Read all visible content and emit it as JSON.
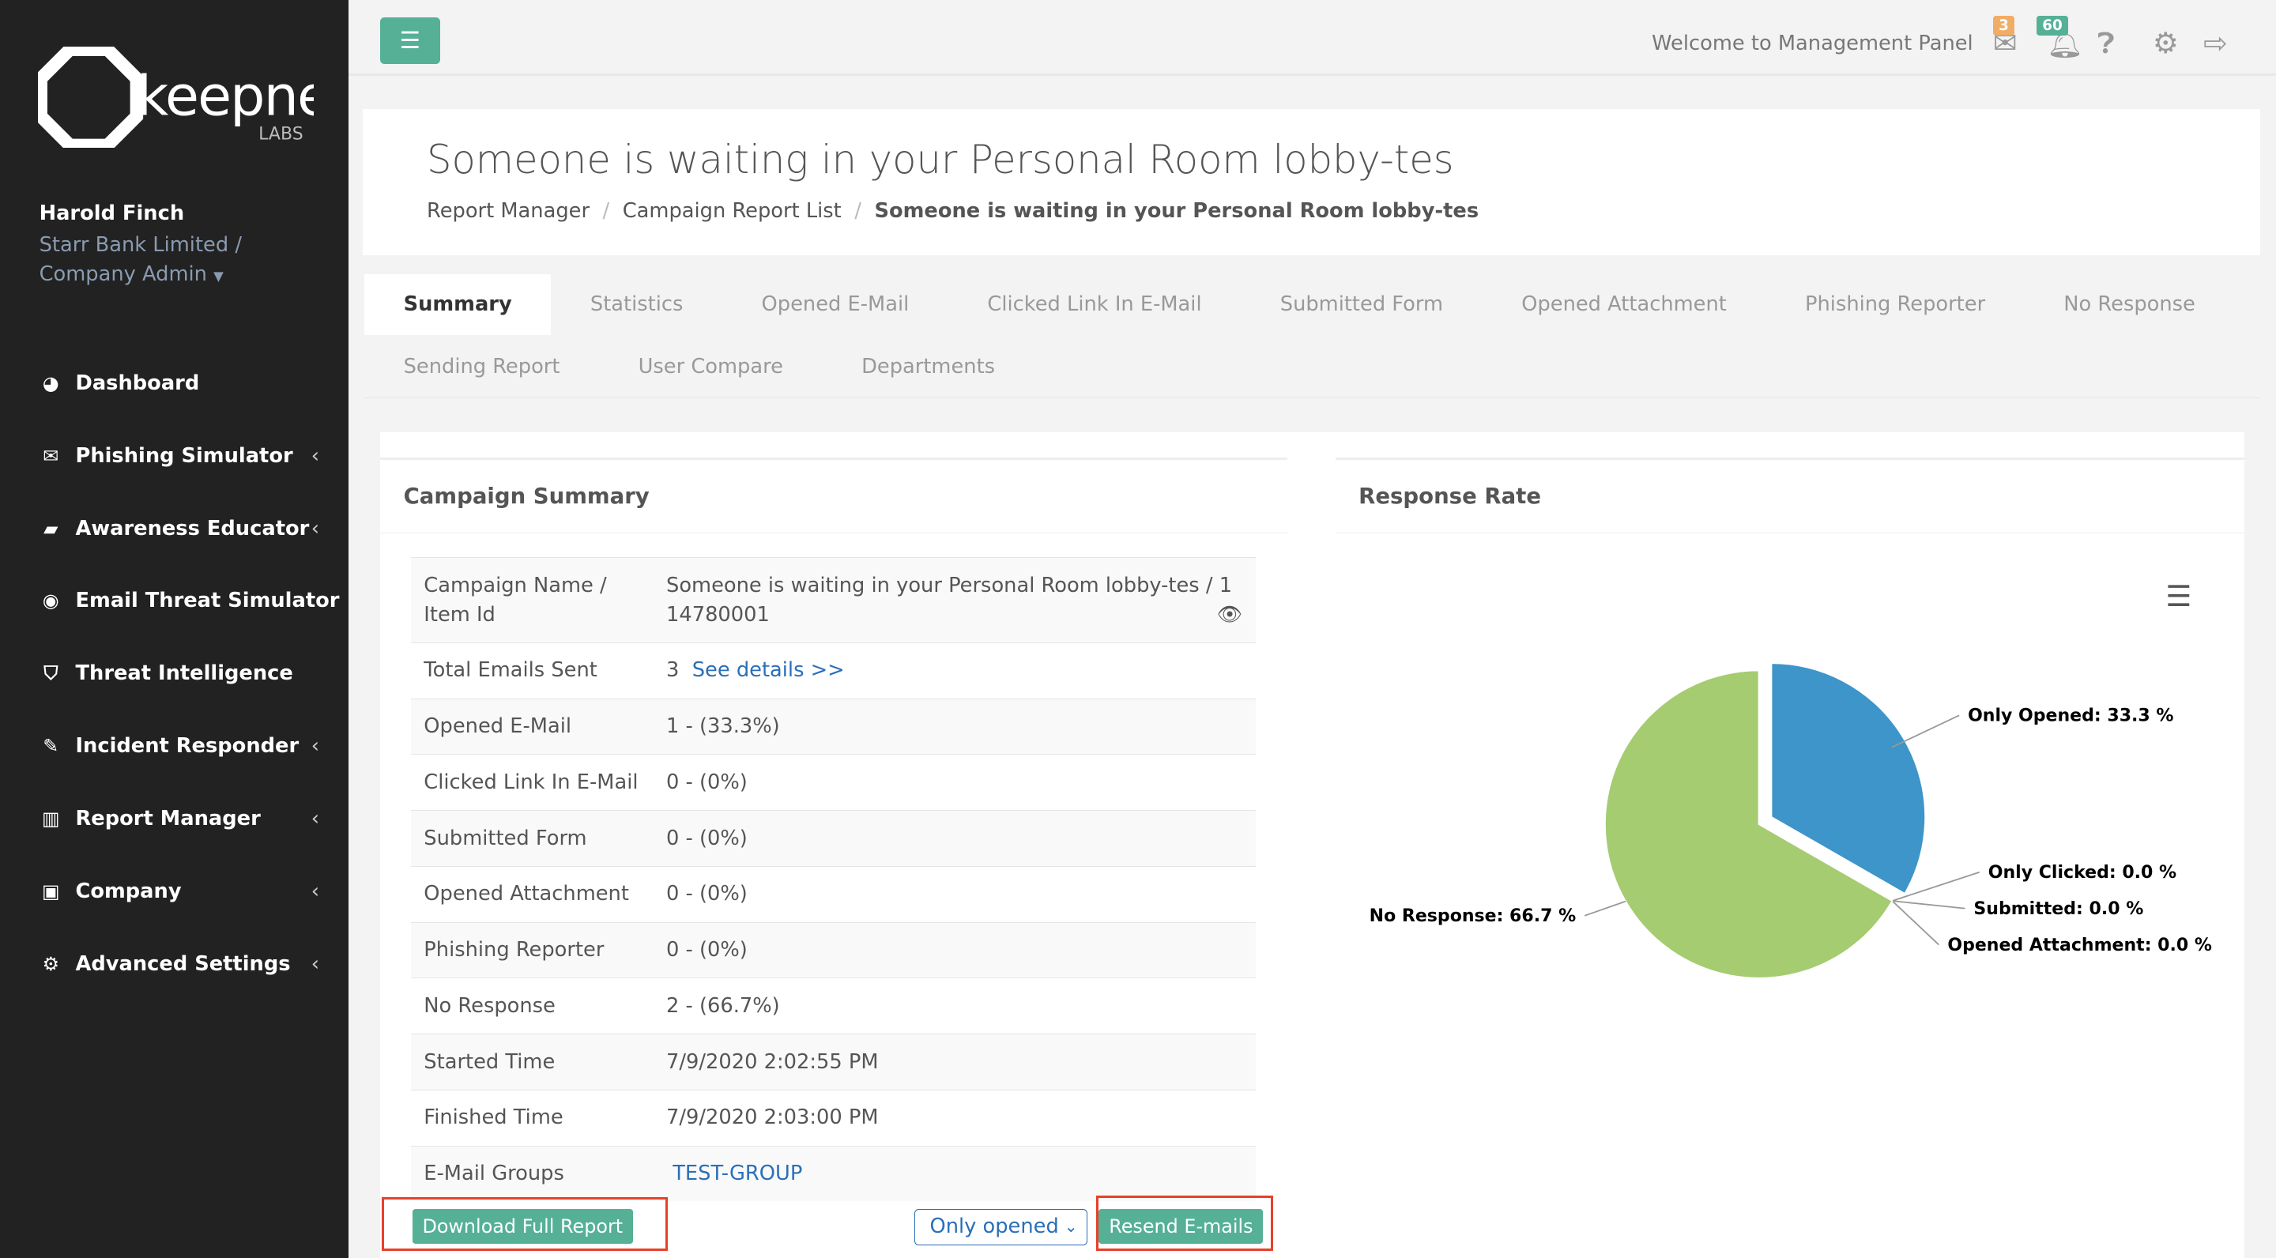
{
  "brand": {
    "name": "keepnet",
    "sub": "LABS"
  },
  "user": {
    "name": "Harold Finch",
    "company": "Starr Bank Limited /",
    "role": "Company Admin"
  },
  "sidebar": {
    "items": [
      {
        "label": "Dashboard",
        "icon": "dashboard-icon",
        "chevron": false
      },
      {
        "label": "Phishing Simulator",
        "icon": "envelope-icon",
        "chevron": true
      },
      {
        "label": "Awareness Educator",
        "icon": "book-icon",
        "chevron": true
      },
      {
        "label": "Email Threat Simulator",
        "icon": "globe-icon",
        "chevron": false
      },
      {
        "label": "Threat Intelligence",
        "icon": "shield-icon",
        "chevron": false
      },
      {
        "label": "Incident Responder",
        "icon": "fire-icon",
        "chevron": true
      },
      {
        "label": "Report Manager",
        "icon": "bar-chart-icon",
        "chevron": true
      },
      {
        "label": "Company",
        "icon": "briefcase-icon",
        "chevron": true
      },
      {
        "label": "Advanced Settings",
        "icon": "gears-icon",
        "chevron": true
      }
    ]
  },
  "topbar": {
    "welcome": "Welcome to Management Panel",
    "mail_count": "3",
    "notif_count": "60",
    "colors": {
      "mail_badge": "#f0ad67",
      "notif_badge": "#55b096"
    }
  },
  "page": {
    "title": "Someone is waiting in your Personal Room lobby-tes",
    "breadcrumb": [
      "Report Manager",
      "Campaign Report List",
      "Someone is waiting in your Personal Room lobby-tes"
    ]
  },
  "tabs": [
    "Summary",
    "Statistics",
    "Opened E-Mail",
    "Clicked Link In E-Mail",
    "Submitted Form",
    "Opened Attachment",
    "Phishing Reporter",
    "No Response",
    "Sending Report",
    "User Compare",
    "Departments"
  ],
  "summary": {
    "title": "Campaign Summary",
    "rows": [
      {
        "k": "Campaign Name / Item Id",
        "v": "Someone is waiting in your Personal Room lobby-tes / 114780001"
      },
      {
        "k": "Total Emails Sent",
        "v": "3",
        "link": "See details >>"
      },
      {
        "k": "Opened E-Mail",
        "v": "1 - (33.3%)"
      },
      {
        "k": "Clicked Link In E-Mail",
        "v": "0 - (0%)"
      },
      {
        "k": "Submitted Form",
        "v": "0 - (0%)"
      },
      {
        "k": "Opened Attachment",
        "v": "0 - (0%)"
      },
      {
        "k": "Phishing Reporter",
        "v": "0 - (0%)"
      },
      {
        "k": "No Response",
        "v": "2 - (66.7%)"
      },
      {
        "k": "Started Time",
        "v": "7/9/2020 2:02:55 PM"
      },
      {
        "k": "Finished Time",
        "v": "7/9/2020 2:03:00 PM"
      },
      {
        "k": "E-Mail Groups",
        "link": "TEST-GROUP"
      }
    ],
    "download_label": "Download Full Report",
    "filter_value": "Only opened",
    "resend_label": "Resend E-mails"
  },
  "chart_data": {
    "type": "pie",
    "title": "Response Rate",
    "slices": [
      {
        "label": "Only Opened",
        "value": 33.3,
        "color": "#3d95c9",
        "text": "Only Opened: 33.3 %"
      },
      {
        "label": "Only Clicked",
        "value": 0.0,
        "color": "#f0ad4e",
        "text": "Only Clicked: 0.0 %"
      },
      {
        "label": "Submitted",
        "value": 0.0,
        "color": "#d9534f",
        "text": "Submitted: 0.0 %"
      },
      {
        "label": "Opened Attachment",
        "value": 0.0,
        "color": "#888888",
        "text": "Opened Attachment: 0.0 %"
      },
      {
        "label": "No Response",
        "value": 66.7,
        "color": "#a5cc70",
        "text": "No Response: 66.7 %"
      }
    ]
  }
}
